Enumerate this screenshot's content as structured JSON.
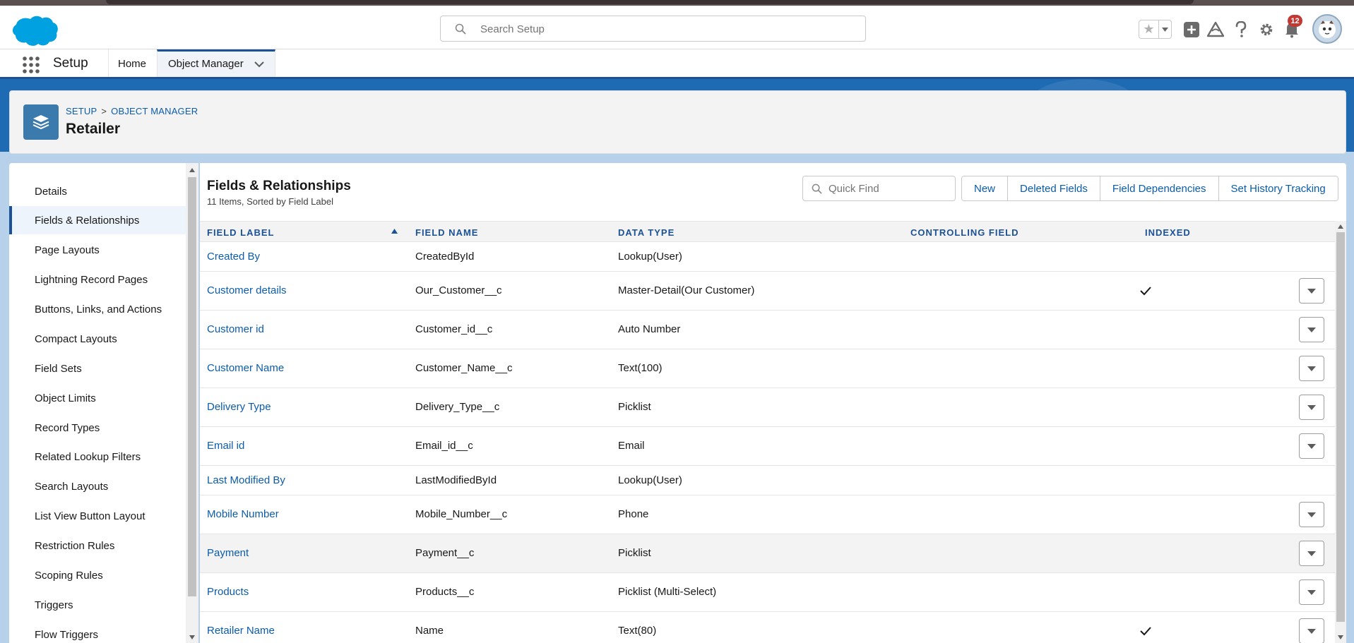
{
  "header": {
    "search_placeholder": "Search Setup",
    "notification_count": "12"
  },
  "nav": {
    "app_name": "Setup",
    "home_label": "Home",
    "object_manager_label": "Object Manager"
  },
  "page_header": {
    "breadcrumb_setup": "SETUP",
    "breadcrumb_separator": ">",
    "breadcrumb_object_manager": "OBJECT MANAGER",
    "title": "Retailer"
  },
  "sidebar": {
    "items": [
      {
        "label": "Details"
      },
      {
        "label": "Fields & Relationships"
      },
      {
        "label": "Page Layouts"
      },
      {
        "label": "Lightning Record Pages"
      },
      {
        "label": "Buttons, Links, and Actions"
      },
      {
        "label": "Compact Layouts"
      },
      {
        "label": "Field Sets"
      },
      {
        "label": "Object Limits"
      },
      {
        "label": "Record Types"
      },
      {
        "label": "Related Lookup Filters"
      },
      {
        "label": "Search Layouts"
      },
      {
        "label": "List View Button Layout"
      },
      {
        "label": "Restriction Rules"
      },
      {
        "label": "Scoping Rules"
      },
      {
        "label": "Triggers"
      },
      {
        "label": "Flow Triggers"
      }
    ]
  },
  "main": {
    "title": "Fields & Relationships",
    "subtitle": "11 Items, Sorted by Field Label",
    "quick_find_placeholder": "Quick Find",
    "buttons": {
      "new": "New",
      "deleted_fields": "Deleted Fields",
      "field_dependencies": "Field Dependencies",
      "set_history_tracking": "Set History Tracking"
    },
    "columns": {
      "field_label": "FIELD LABEL",
      "field_name": "FIELD NAME",
      "data_type": "DATA TYPE",
      "controlling_field": "CONTROLLING FIELD",
      "indexed": "INDEXED"
    },
    "rows": [
      {
        "label": "Created By",
        "name": "CreatedById",
        "type": "Lookup(User)",
        "indexed": false,
        "menu": false
      },
      {
        "label": "Customer details",
        "name": "Our_Customer__c",
        "type": "Master-Detail(Our Customer)",
        "indexed": true,
        "menu": true
      },
      {
        "label": "Customer id",
        "name": "Customer_id__c",
        "type": "Auto Number",
        "indexed": false,
        "menu": true
      },
      {
        "label": "Customer Name",
        "name": "Customer_Name__c",
        "type": "Text(100)",
        "indexed": false,
        "menu": true
      },
      {
        "label": "Delivery Type",
        "name": "Delivery_Type__c",
        "type": "Picklist",
        "indexed": false,
        "menu": true
      },
      {
        "label": "Email id",
        "name": "Email_id__c",
        "type": "Email",
        "indexed": false,
        "menu": true
      },
      {
        "label": "Last Modified By",
        "name": "LastModifiedById",
        "type": "Lookup(User)",
        "indexed": false,
        "menu": false
      },
      {
        "label": "Mobile Number",
        "name": "Mobile_Number__c",
        "type": "Phone",
        "indexed": false,
        "menu": true
      },
      {
        "label": "Payment",
        "name": "Payment__c",
        "type": "Picklist",
        "indexed": false,
        "menu": true
      },
      {
        "label": "Products",
        "name": "Products__c",
        "type": "Picklist (Multi-Select)",
        "indexed": false,
        "menu": true
      },
      {
        "label": "Retailer Name",
        "name": "Name",
        "type": "Text(80)",
        "indexed": true,
        "menu": true
      }
    ]
  },
  "colors": {
    "brand_blue": "#1b5297",
    "link_blue": "#0b5cab",
    "salesforce_cloud": "#00a1e0",
    "object_icon_bg": "#3b7aac",
    "notification_red": "#c23934"
  },
  "icons": {
    "logo": "salesforce-cloud-logo",
    "search": "search-icon",
    "favorite": "star-icon",
    "add": "plus-icon",
    "trailhead": "trailhead-icon",
    "help": "question-icon",
    "settings": "gear-icon",
    "notifications": "bell-icon",
    "app_launcher": "waffle-icon",
    "object": "layers-icon"
  }
}
